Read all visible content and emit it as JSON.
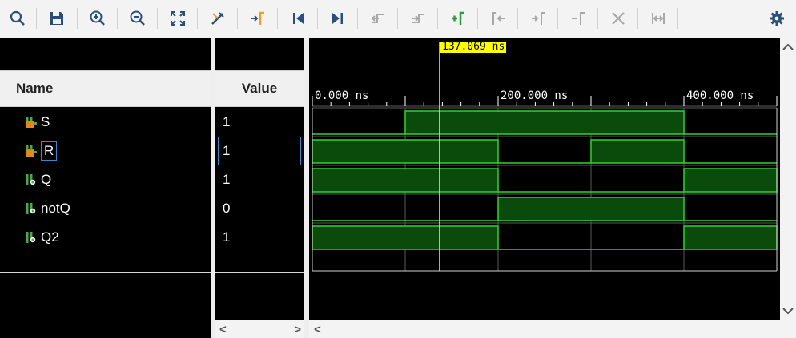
{
  "toolbar": {
    "icons": [
      "search-icon",
      "save-icon",
      "zoom-in-icon",
      "zoom-out-icon",
      "zoom-fit-icon",
      "snap-icon",
      "go-to-cursor-icon",
      "go-to-start-icon",
      "go-to-end-icon",
      "previous-transition-icon",
      "next-transition-icon",
      "add-marker-icon",
      "previous-marker-icon",
      "next-marker-icon",
      "swap-cursors-icon",
      "delete-marker-icon",
      "marker-distance-icon",
      "settings-icon"
    ]
  },
  "name_pane": {
    "header": "Name",
    "signals": [
      {
        "name": "S",
        "icon": "input-port-icon"
      },
      {
        "name": "R",
        "icon": "input-port-icon",
        "selected": true
      },
      {
        "name": "Q",
        "icon": "output-port-icon"
      },
      {
        "name": "notQ",
        "icon": "output-port-icon"
      },
      {
        "name": "Q2",
        "icon": "output-port-icon"
      }
    ]
  },
  "value_pane": {
    "header": "Value",
    "values": [
      "1",
      "1",
      "1",
      "0",
      "1"
    ]
  },
  "wave": {
    "cursor_label": "137.069 ns",
    "cursor_time_ns": 137.069,
    "time_start_ns": 0,
    "time_end_ns": 500,
    "tick_labels": [
      {
        "text": "0.000 ns",
        "time_ns": 0
      },
      {
        "text": "200.000 ns",
        "time_ns": 200
      },
      {
        "text": "400.000 ns",
        "time_ns": 400
      }
    ],
    "signals": [
      {
        "name": "S",
        "high": [
          [
            100,
            400
          ]
        ]
      },
      {
        "name": "R",
        "high": [
          [
            0,
            200
          ],
          [
            300,
            400
          ]
        ]
      },
      {
        "name": "Q",
        "high": [
          [
            0,
            200
          ],
          [
            400,
            500
          ]
        ]
      },
      {
        "name": "notQ",
        "high": [
          [
            200,
            400
          ]
        ]
      },
      {
        "name": "Q2",
        "high": [
          [
            0,
            200
          ],
          [
            400,
            500
          ]
        ]
      }
    ],
    "colors": {
      "wave_fill": "#0a4a0a",
      "wave_line": "#35d035",
      "grid": "#5a5a5a",
      "cursor": "#ffff00"
    }
  }
}
